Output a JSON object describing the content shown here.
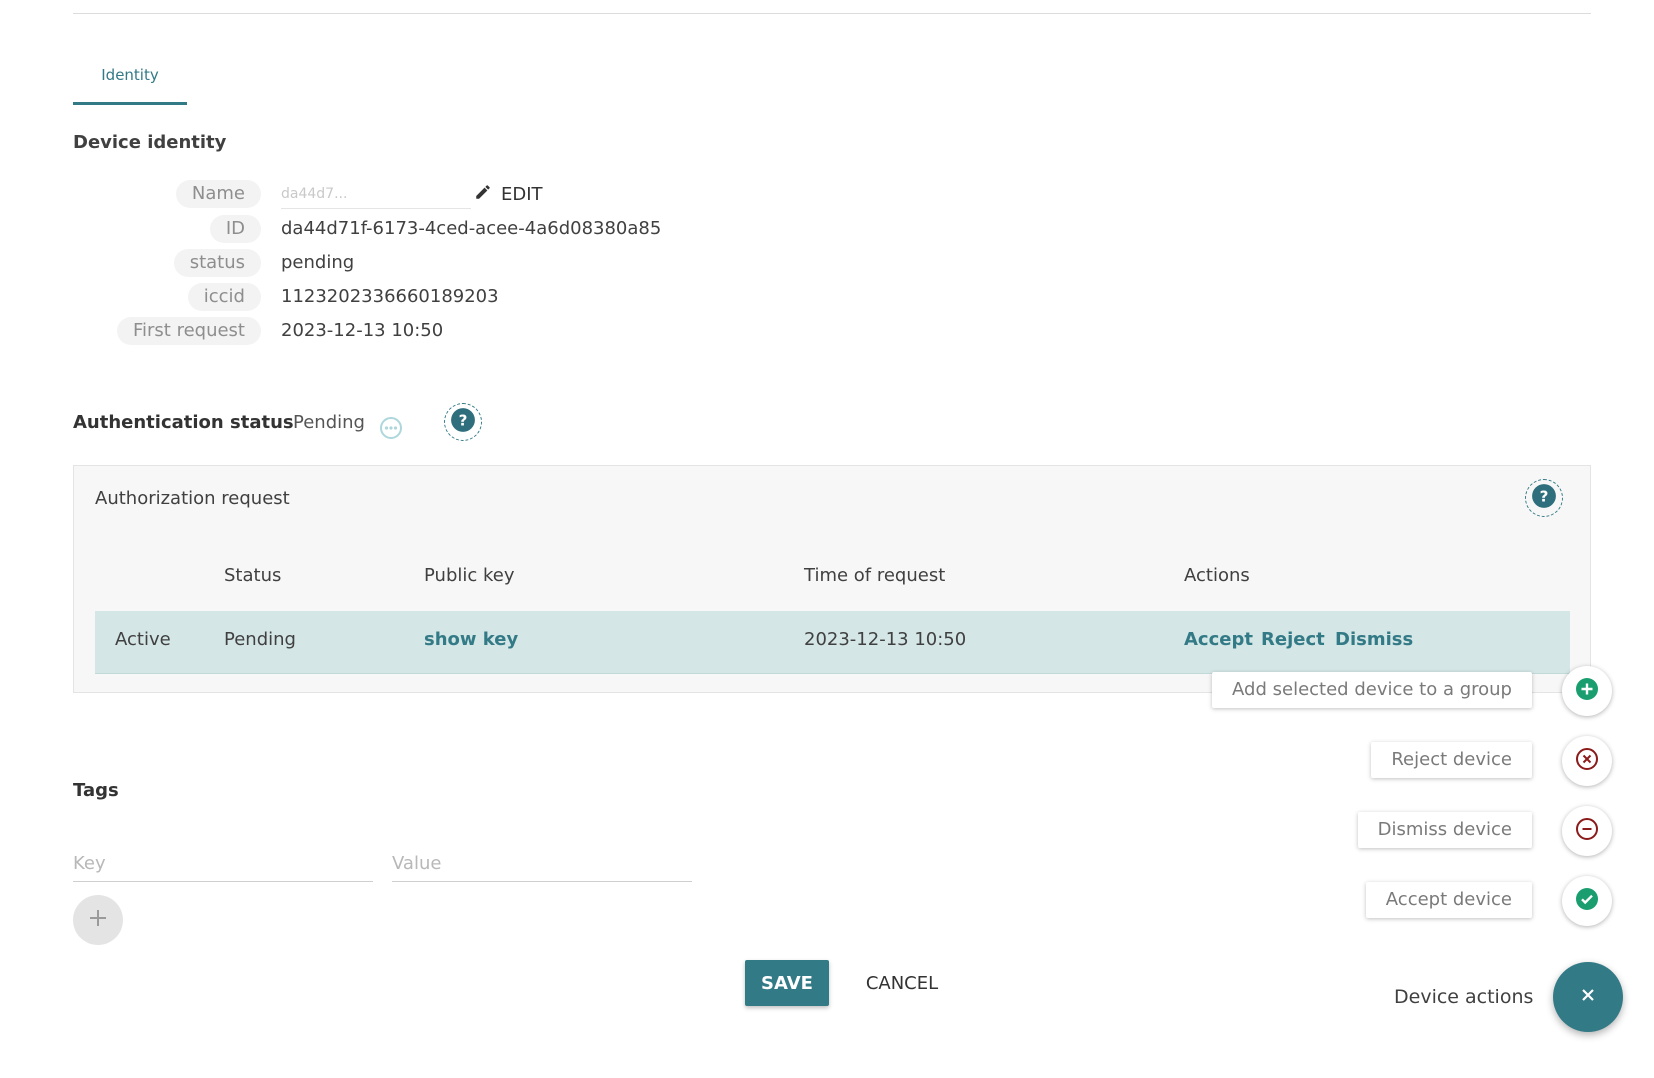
{
  "tabs": [
    {
      "label": "Identity"
    }
  ],
  "device_identity": {
    "title": "Device identity",
    "name": {
      "key": "Name",
      "value": "da44d7..."
    },
    "edit_label": "EDIT",
    "id": {
      "key": "ID",
      "value": "da44d71f-6173-4ced-acee-4a6d08380a85"
    },
    "status": {
      "key": "status",
      "value": "pending"
    },
    "iccid": {
      "key": "iccid",
      "value": "1123202336660189203"
    },
    "first_request": {
      "key": "First request",
      "value": "2023-12-13 10:50"
    }
  },
  "authentication": {
    "label": "Authentication status",
    "value": "Pending"
  },
  "auth_request": {
    "title": "Authorization request",
    "columns": [
      "Status",
      "Public key",
      "Time of request",
      "Actions"
    ],
    "row": {
      "state": "Active",
      "status": "Pending",
      "public_key_link": "show key",
      "time": "2023-12-13 10:50",
      "actions": [
        "Accept",
        "Reject",
        "Dismiss"
      ]
    }
  },
  "tags": {
    "title": "Tags",
    "key_placeholder": "Key",
    "value_placeholder": "Value"
  },
  "buttons": {
    "save": "SAVE",
    "cancel": "CANCEL"
  },
  "device_actions": {
    "label": "Device actions",
    "items": [
      {
        "label": "Add selected device to a group",
        "icon": "add-circle-icon",
        "color": "#1a9e70"
      },
      {
        "label": "Reject device",
        "icon": "cancel-circle-icon",
        "color": "#8b1a1a"
      },
      {
        "label": "Dismiss device",
        "icon": "remove-circle-icon",
        "color": "#8b1a1a"
      },
      {
        "label": "Accept device",
        "icon": "check-circle-icon",
        "color": "#1a9e70"
      }
    ]
  },
  "colors": {
    "accent": "#337a87",
    "row_highlight": "#d4e6e6"
  }
}
